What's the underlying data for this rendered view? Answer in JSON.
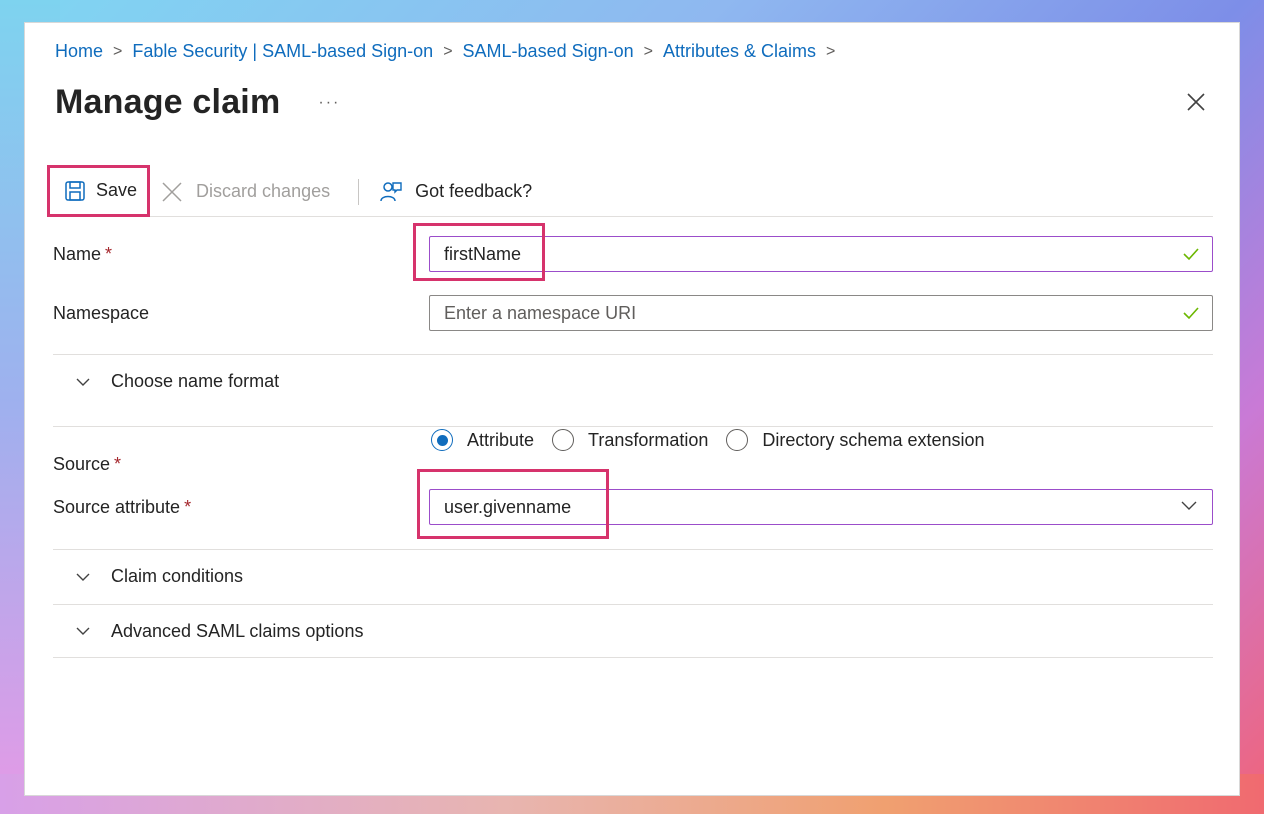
{
  "breadcrumb": {
    "items": [
      "Home",
      "Fable Security | SAML-based Sign-on",
      "SAML-based Sign-on",
      "Attributes & Claims"
    ],
    "separator": ">"
  },
  "page": {
    "title": "Manage claim",
    "more": "···"
  },
  "toolbar": {
    "save_label": "Save",
    "discard_label": "Discard changes",
    "feedback_label": "Got feedback?"
  },
  "form": {
    "name": {
      "label": "Name",
      "required": "*",
      "value": "firstName"
    },
    "namespace": {
      "label": "Namespace",
      "placeholder": "Enter a namespace URI"
    },
    "name_format": {
      "label": "Choose name format"
    },
    "source": {
      "label": "Source",
      "required": "*",
      "options": [
        "Attribute",
        "Transformation",
        "Directory schema extension"
      ],
      "selected": "Attribute"
    },
    "source_attribute": {
      "label": "Source attribute",
      "required": "*",
      "value": "user.givenname"
    },
    "claim_conditions": {
      "label": "Claim conditions"
    },
    "advanced": {
      "label": "Advanced SAML claims options"
    }
  },
  "colors": {
    "accent": "#0f6cbd",
    "highlight": "#d6336c",
    "required": "#a4262c",
    "valid": "#6bb700"
  },
  "icons": [
    "save-icon",
    "discard-icon",
    "feedback-icon",
    "close-icon",
    "check-icon",
    "chevron-down-icon"
  ]
}
